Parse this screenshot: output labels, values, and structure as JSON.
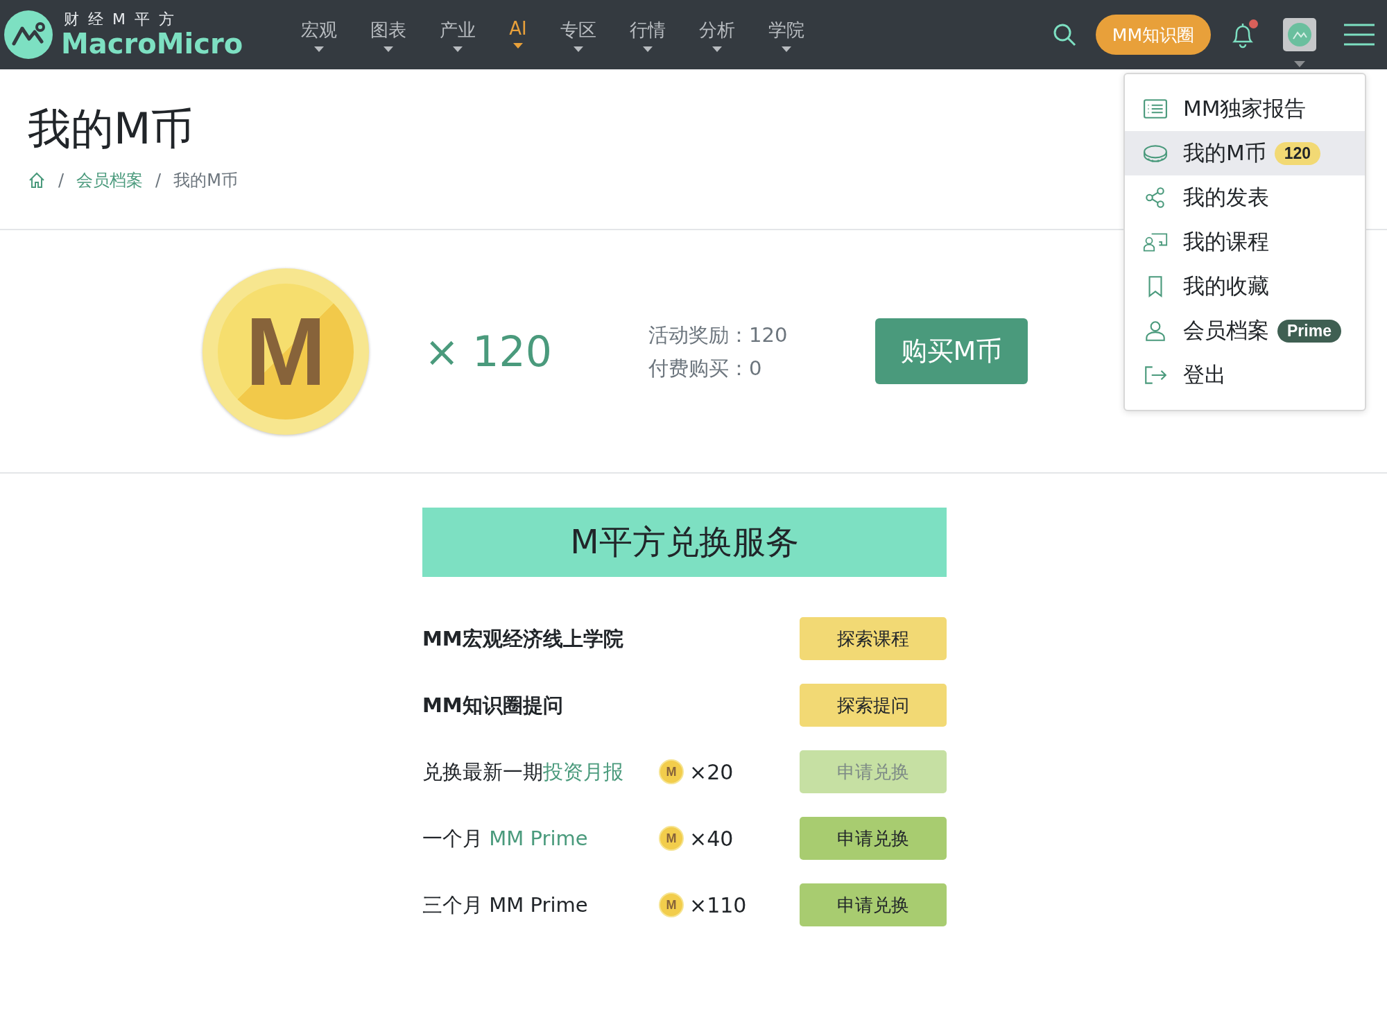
{
  "logo": {
    "subtitle": "财 经 M 平 方",
    "name": "MacroMicro"
  },
  "nav": [
    {
      "label": "宏观",
      "selected": false
    },
    {
      "label": "图表",
      "selected": false
    },
    {
      "label": "产业",
      "selected": false
    },
    {
      "label": "AI",
      "selected": true
    },
    {
      "label": "专区",
      "selected": false
    },
    {
      "label": "行情",
      "selected": false
    },
    {
      "label": "分析",
      "selected": false
    },
    {
      "label": "学院",
      "selected": false
    }
  ],
  "header_button": "MM知识圈",
  "notification_unread": true,
  "page_title": "我的M币",
  "breadcrumb": [
    {
      "separator": "/",
      "label": "会员档案",
      "kind": "link"
    },
    {
      "separator": "/",
      "label": "我的M币",
      "kind": "current"
    }
  ],
  "balance": {
    "coin_letter": "M",
    "amount": "× 120",
    "stats": [
      "活动奖励：120",
      "付费购买：0"
    ],
    "buy_button": "购买M币"
  },
  "services": {
    "title": "M平方兑换服务",
    "rows": [
      {
        "kind": "explore",
        "title": "MM宏观经济线上学院",
        "button": "探索课程"
      },
      {
        "kind": "explore",
        "title": "MM知识圈提问",
        "button": "探索提问"
      },
      {
        "kind": "exchange",
        "title": "兑换最新一期",
        "link": "投资月报",
        "coin_letter": "M",
        "cost": "×20",
        "button": "申请兑换",
        "disabled": true
      },
      {
        "kind": "exchange",
        "title": "一个月 ",
        "link": "MM Prime",
        "coin_letter": "M",
        "cost": "×40",
        "button": "申请兑换",
        "disabled": false
      },
      {
        "kind": "exchange",
        "title": "三个月 MM Prime",
        "coin_letter": "M",
        "cost": "×110",
        "button": "申请兑换",
        "disabled": false
      }
    ]
  },
  "user_menu": [
    {
      "kind": "reports",
      "label": "MM独家报告",
      "selected": false
    },
    {
      "kind": "coins",
      "label": "我的M币",
      "badge": "120",
      "selected": true
    },
    {
      "kind": "posts",
      "label": "我的发表",
      "selected": false
    },
    {
      "kind": "courses",
      "label": "我的课程",
      "selected": false
    },
    {
      "kind": "saved",
      "label": "我的收藏",
      "selected": false
    },
    {
      "kind": "profile",
      "label": "会员档案",
      "badge": "Prime",
      "selected": false
    },
    {
      "kind": "logout",
      "label": "登出",
      "selected": false
    }
  ]
}
